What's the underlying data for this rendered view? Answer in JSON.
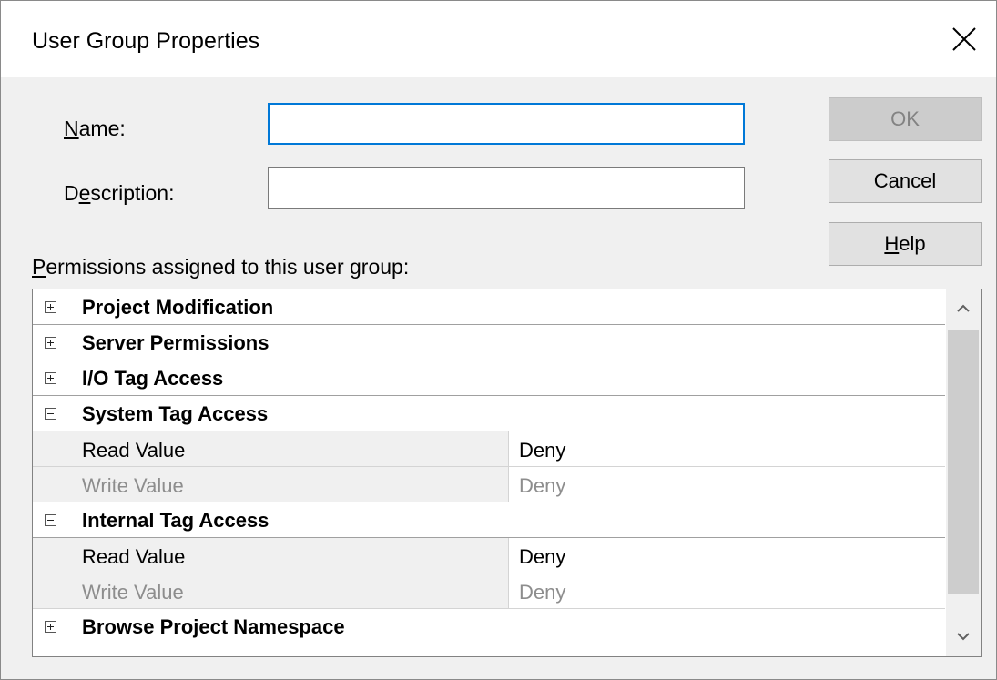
{
  "dialog": {
    "title": "User Group Properties",
    "close_icon": "close-icon"
  },
  "form": {
    "name_label_accel": "N",
    "name_label_rest": "ame:",
    "name_value": "",
    "description_label_pre": "D",
    "description_label_accel": "e",
    "description_label_rest": "scription:",
    "description_value": "",
    "permissions_label_accel": "P",
    "permissions_label_rest": "ermissions assigned to this user group:"
  },
  "buttons": {
    "ok": "OK",
    "cancel": "Cancel",
    "help_accel": "H",
    "help_rest": "elp"
  },
  "grid": {
    "categories": [
      {
        "label": "Project Modification",
        "expanded": false
      },
      {
        "label": "Server Permissions",
        "expanded": false
      },
      {
        "label": "I/O Tag Access",
        "expanded": false
      },
      {
        "label": "System Tag Access",
        "expanded": true,
        "properties": [
          {
            "name": "Read Value",
            "value": "Deny",
            "enabled": true
          },
          {
            "name": "Write Value",
            "value": "Deny",
            "enabled": false
          }
        ]
      },
      {
        "label": "Internal Tag Access",
        "expanded": true,
        "properties": [
          {
            "name": "Read Value",
            "value": "Deny",
            "enabled": true
          },
          {
            "name": "Write Value",
            "value": "Deny",
            "enabled": false
          }
        ]
      },
      {
        "label": "Browse Project Namespace",
        "expanded": false
      }
    ]
  },
  "colors": {
    "focus_border": "#0078d7",
    "dialog_bg": "#f0f0f0",
    "disabled_text": "#8d8d8d"
  }
}
